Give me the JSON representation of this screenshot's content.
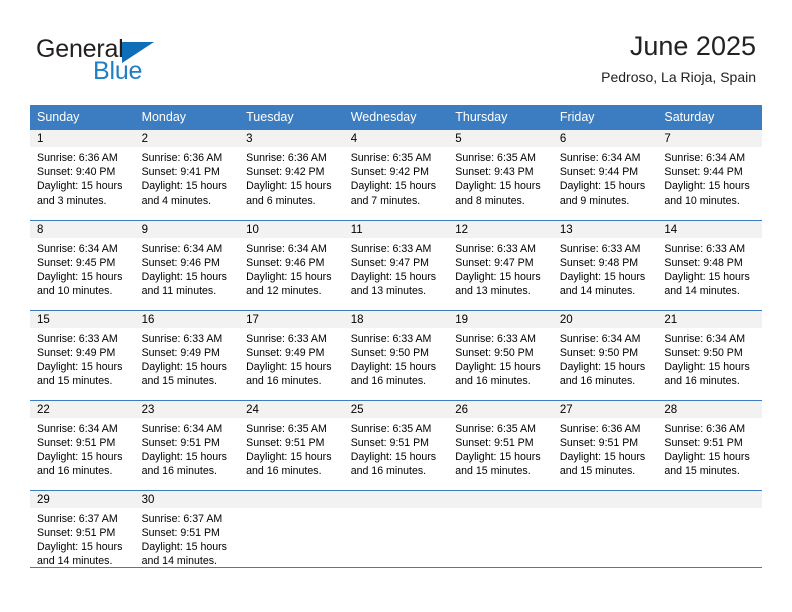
{
  "brand": {
    "name_top": "General",
    "name_bottom": "Blue",
    "logo_icon": "triangle-logo-icon",
    "color_top": "#231f20",
    "color_bottom": "#1f7fc4",
    "triangle_color": "#0e6eb8"
  },
  "header": {
    "title": "June 2025",
    "location": "Pedroso, La Rioja, Spain"
  },
  "theme": {
    "header_bg": "#3b7dc0",
    "header_text": "#ffffff",
    "daynum_band_bg": "#f2f2f2",
    "row_rule": "#3b7dc0"
  },
  "weekdays": [
    "Sunday",
    "Monday",
    "Tuesday",
    "Wednesday",
    "Thursday",
    "Friday",
    "Saturday"
  ],
  "weeks": [
    [
      {
        "day": "1",
        "sunrise": "Sunrise: 6:36 AM",
        "sunset": "Sunset: 9:40 PM",
        "daylight_line1": "Daylight: 15 hours",
        "daylight_line2": "and 3 minutes."
      },
      {
        "day": "2",
        "sunrise": "Sunrise: 6:36 AM",
        "sunset": "Sunset: 9:41 PM",
        "daylight_line1": "Daylight: 15 hours",
        "daylight_line2": "and 4 minutes."
      },
      {
        "day": "3",
        "sunrise": "Sunrise: 6:36 AM",
        "sunset": "Sunset: 9:42 PM",
        "daylight_line1": "Daylight: 15 hours",
        "daylight_line2": "and 6 minutes."
      },
      {
        "day": "4",
        "sunrise": "Sunrise: 6:35 AM",
        "sunset": "Sunset: 9:42 PM",
        "daylight_line1": "Daylight: 15 hours",
        "daylight_line2": "and 7 minutes."
      },
      {
        "day": "5",
        "sunrise": "Sunrise: 6:35 AM",
        "sunset": "Sunset: 9:43 PM",
        "daylight_line1": "Daylight: 15 hours",
        "daylight_line2": "and 8 minutes."
      },
      {
        "day": "6",
        "sunrise": "Sunrise: 6:34 AM",
        "sunset": "Sunset: 9:44 PM",
        "daylight_line1": "Daylight: 15 hours",
        "daylight_line2": "and 9 minutes."
      },
      {
        "day": "7",
        "sunrise": "Sunrise: 6:34 AM",
        "sunset": "Sunset: 9:44 PM",
        "daylight_line1": "Daylight: 15 hours",
        "daylight_line2": "and 10 minutes."
      }
    ],
    [
      {
        "day": "8",
        "sunrise": "Sunrise: 6:34 AM",
        "sunset": "Sunset: 9:45 PM",
        "daylight_line1": "Daylight: 15 hours",
        "daylight_line2": "and 10 minutes."
      },
      {
        "day": "9",
        "sunrise": "Sunrise: 6:34 AM",
        "sunset": "Sunset: 9:46 PM",
        "daylight_line1": "Daylight: 15 hours",
        "daylight_line2": "and 11 minutes."
      },
      {
        "day": "10",
        "sunrise": "Sunrise: 6:34 AM",
        "sunset": "Sunset: 9:46 PM",
        "daylight_line1": "Daylight: 15 hours",
        "daylight_line2": "and 12 minutes."
      },
      {
        "day": "11",
        "sunrise": "Sunrise: 6:33 AM",
        "sunset": "Sunset: 9:47 PM",
        "daylight_line1": "Daylight: 15 hours",
        "daylight_line2": "and 13 minutes."
      },
      {
        "day": "12",
        "sunrise": "Sunrise: 6:33 AM",
        "sunset": "Sunset: 9:47 PM",
        "daylight_line1": "Daylight: 15 hours",
        "daylight_line2": "and 13 minutes."
      },
      {
        "day": "13",
        "sunrise": "Sunrise: 6:33 AM",
        "sunset": "Sunset: 9:48 PM",
        "daylight_line1": "Daylight: 15 hours",
        "daylight_line2": "and 14 minutes."
      },
      {
        "day": "14",
        "sunrise": "Sunrise: 6:33 AM",
        "sunset": "Sunset: 9:48 PM",
        "daylight_line1": "Daylight: 15 hours",
        "daylight_line2": "and 14 minutes."
      }
    ],
    [
      {
        "day": "15",
        "sunrise": "Sunrise: 6:33 AM",
        "sunset": "Sunset: 9:49 PM",
        "daylight_line1": "Daylight: 15 hours",
        "daylight_line2": "and 15 minutes."
      },
      {
        "day": "16",
        "sunrise": "Sunrise: 6:33 AM",
        "sunset": "Sunset: 9:49 PM",
        "daylight_line1": "Daylight: 15 hours",
        "daylight_line2": "and 15 minutes."
      },
      {
        "day": "17",
        "sunrise": "Sunrise: 6:33 AM",
        "sunset": "Sunset: 9:49 PM",
        "daylight_line1": "Daylight: 15 hours",
        "daylight_line2": "and 16 minutes."
      },
      {
        "day": "18",
        "sunrise": "Sunrise: 6:33 AM",
        "sunset": "Sunset: 9:50 PM",
        "daylight_line1": "Daylight: 15 hours",
        "daylight_line2": "and 16 minutes."
      },
      {
        "day": "19",
        "sunrise": "Sunrise: 6:33 AM",
        "sunset": "Sunset: 9:50 PM",
        "daylight_line1": "Daylight: 15 hours",
        "daylight_line2": "and 16 minutes."
      },
      {
        "day": "20",
        "sunrise": "Sunrise: 6:34 AM",
        "sunset": "Sunset: 9:50 PM",
        "daylight_line1": "Daylight: 15 hours",
        "daylight_line2": "and 16 minutes."
      },
      {
        "day": "21",
        "sunrise": "Sunrise: 6:34 AM",
        "sunset": "Sunset: 9:50 PM",
        "daylight_line1": "Daylight: 15 hours",
        "daylight_line2": "and 16 minutes."
      }
    ],
    [
      {
        "day": "22",
        "sunrise": "Sunrise: 6:34 AM",
        "sunset": "Sunset: 9:51 PM",
        "daylight_line1": "Daylight: 15 hours",
        "daylight_line2": "and 16 minutes."
      },
      {
        "day": "23",
        "sunrise": "Sunrise: 6:34 AM",
        "sunset": "Sunset: 9:51 PM",
        "daylight_line1": "Daylight: 15 hours",
        "daylight_line2": "and 16 minutes."
      },
      {
        "day": "24",
        "sunrise": "Sunrise: 6:35 AM",
        "sunset": "Sunset: 9:51 PM",
        "daylight_line1": "Daylight: 15 hours",
        "daylight_line2": "and 16 minutes."
      },
      {
        "day": "25",
        "sunrise": "Sunrise: 6:35 AM",
        "sunset": "Sunset: 9:51 PM",
        "daylight_line1": "Daylight: 15 hours",
        "daylight_line2": "and 16 minutes."
      },
      {
        "day": "26",
        "sunrise": "Sunrise: 6:35 AM",
        "sunset": "Sunset: 9:51 PM",
        "daylight_line1": "Daylight: 15 hours",
        "daylight_line2": "and 15 minutes."
      },
      {
        "day": "27",
        "sunrise": "Sunrise: 6:36 AM",
        "sunset": "Sunset: 9:51 PM",
        "daylight_line1": "Daylight: 15 hours",
        "daylight_line2": "and 15 minutes."
      },
      {
        "day": "28",
        "sunrise": "Sunrise: 6:36 AM",
        "sunset": "Sunset: 9:51 PM",
        "daylight_line1": "Daylight: 15 hours",
        "daylight_line2": "and 15 minutes."
      }
    ],
    [
      {
        "day": "29",
        "sunrise": "Sunrise: 6:37 AM",
        "sunset": "Sunset: 9:51 PM",
        "daylight_line1": "Daylight: 15 hours",
        "daylight_line2": "and 14 minutes."
      },
      {
        "day": "30",
        "sunrise": "Sunrise: 6:37 AM",
        "sunset": "Sunset: 9:51 PM",
        "daylight_line1": "Daylight: 15 hours",
        "daylight_line2": "and 14 minutes."
      },
      {
        "day": "",
        "sunrise": "",
        "sunset": "",
        "daylight_line1": "",
        "daylight_line2": ""
      },
      {
        "day": "",
        "sunrise": "",
        "sunset": "",
        "daylight_line1": "",
        "daylight_line2": ""
      },
      {
        "day": "",
        "sunrise": "",
        "sunset": "",
        "daylight_line1": "",
        "daylight_line2": ""
      },
      {
        "day": "",
        "sunrise": "",
        "sunset": "",
        "daylight_line1": "",
        "daylight_line2": ""
      },
      {
        "day": "",
        "sunrise": "",
        "sunset": "",
        "daylight_line1": "",
        "daylight_line2": ""
      }
    ]
  ]
}
